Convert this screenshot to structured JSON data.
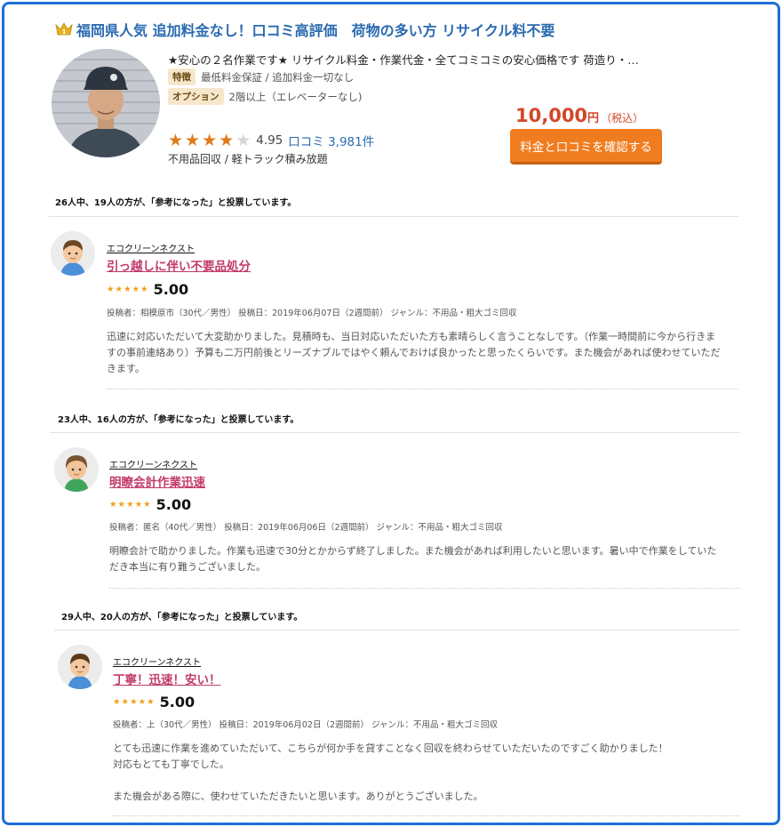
{
  "header": {
    "title": "福岡県人気 追加料金なし！口コミ高評価　荷物の多い方 リサイクル料不要",
    "tagline": "★安心の２名作業です★ リサイクル料金・作業代金・全てコミコミの安心価格です 荷造り・…",
    "feature": {
      "tag": "特徴",
      "text": "最低料金保証 / 追加料金一切なし"
    },
    "option": {
      "tag": "オプション",
      "text": "2階以上（エレベーターなし)"
    },
    "rating": {
      "value": "4.95",
      "stars": 4,
      "max_stars": 5,
      "review_label": "口コミ 3,981件"
    },
    "subline": "不用品回収 / 軽トラック積み放題",
    "price": {
      "amount": "10,000",
      "unit": "円",
      "tax": "（税込）"
    },
    "cta_label": "料金と口コミを確認する",
    "colors": {
      "title": "#2a6ab0",
      "price": "#d2472a",
      "cta": "#ef7d1f",
      "review_title": "#c23a6b",
      "frame": "#1f6fd6"
    }
  },
  "reviews": [
    {
      "helpful": "26人中、19人の方が、「参考になった」と投票しています。",
      "company": "エコクリーンネクスト",
      "title": "引っ越しに伴い不要品処分",
      "score": "5.00",
      "stars": 5,
      "meta": "投稿者：相模原市（30代／男性）  投稿日：2019年06月07日（2週間前）  ジャンル：不用品・粗大ゴミ回収",
      "body": [
        "迅速に対応いただいて大変助かりました。見積時も、当日対応いただいた方も素晴らしく言うことなしです。（作業一時間前に今から行きま",
        "すの事前連絡あり）予算も二万円前後とリーズナブルではやく頼んでおけば良かったと思ったくらいです。また機会があれば使わせていただ",
        "きます。"
      ]
    },
    {
      "helpful": "23人中、16人の方が、「参考になった」と投票しています。",
      "company": "エコクリーンネクスト",
      "title": "明瞭会計作業迅速",
      "score": "5.00",
      "stars": 5,
      "meta": "投稿者：匿名（40代／男性）  投稿日：2019年06月06日（2週間前）  ジャンル：不用品・粗大ゴミ回収",
      "body": [
        "明瞭会計で助かりました。作業も迅速で30分とかからず終了しました。また機会があれば利用したいと思います。暑い中で作業をしていた",
        "だき本当に有り難うございました。"
      ]
    },
    {
      "helpful": "29人中、20人の方が、「参考になった」と投票しています。",
      "company": "エコクリーンネクスト",
      "title": "丁寧！迅速！安い！",
      "score": "5.00",
      "stars": 5,
      "meta": "投稿者：上（30代／男性）  投稿日：2019年06月02日（2週間前）  ジャンル：不用品・粗大ゴミ回収",
      "body": [
        "とても迅速に作業を進めていただいて、こちらが何か手を貸すことなく回収を終わらせていただいたのですごく助かりました！",
        "対応もとても丁寧でした。",
        "",
        "また機会がある際に、使わせていただきたいと思います。ありがとうございました。"
      ]
    }
  ]
}
